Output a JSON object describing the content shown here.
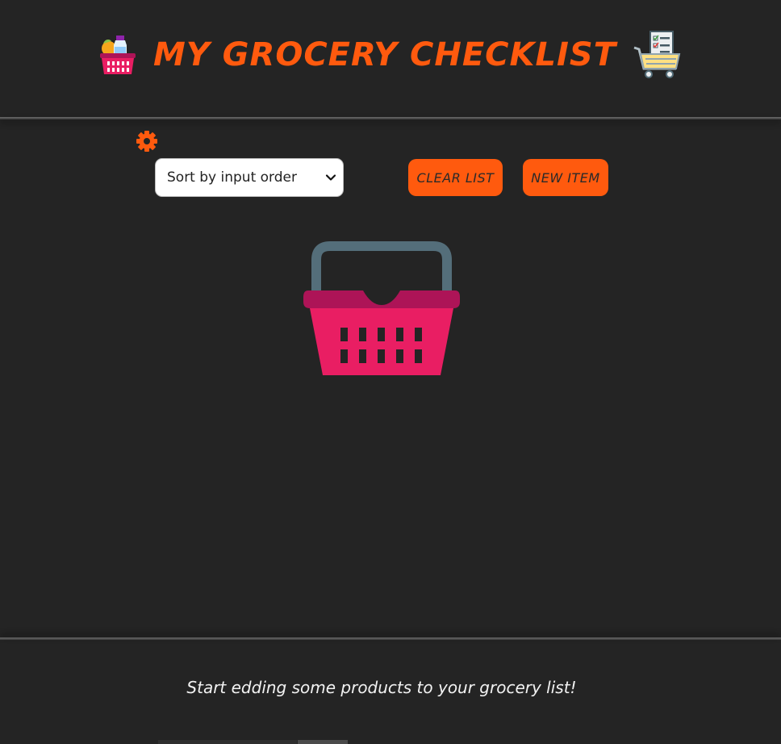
{
  "header": {
    "title": "MY GROCERY CHECKLIST",
    "left_icon": "grocery-basket-icon",
    "right_icon": "shopping-cart-checklist-icon"
  },
  "controls": {
    "settings_icon": "gear-icon",
    "sort_selected": "Sort by input order",
    "clear_label": "CLEAR LIST",
    "new_item_label": "NEW ITEM"
  },
  "empty_state": {
    "icon": "basket-icon",
    "message": "Start edding some products to your grocery list!"
  },
  "colors": {
    "accent": "#ff5a0e",
    "background": "#242424",
    "basket_body": "#e91e63",
    "basket_rim": "#ad1457",
    "basket_handle": "#546e7a"
  }
}
